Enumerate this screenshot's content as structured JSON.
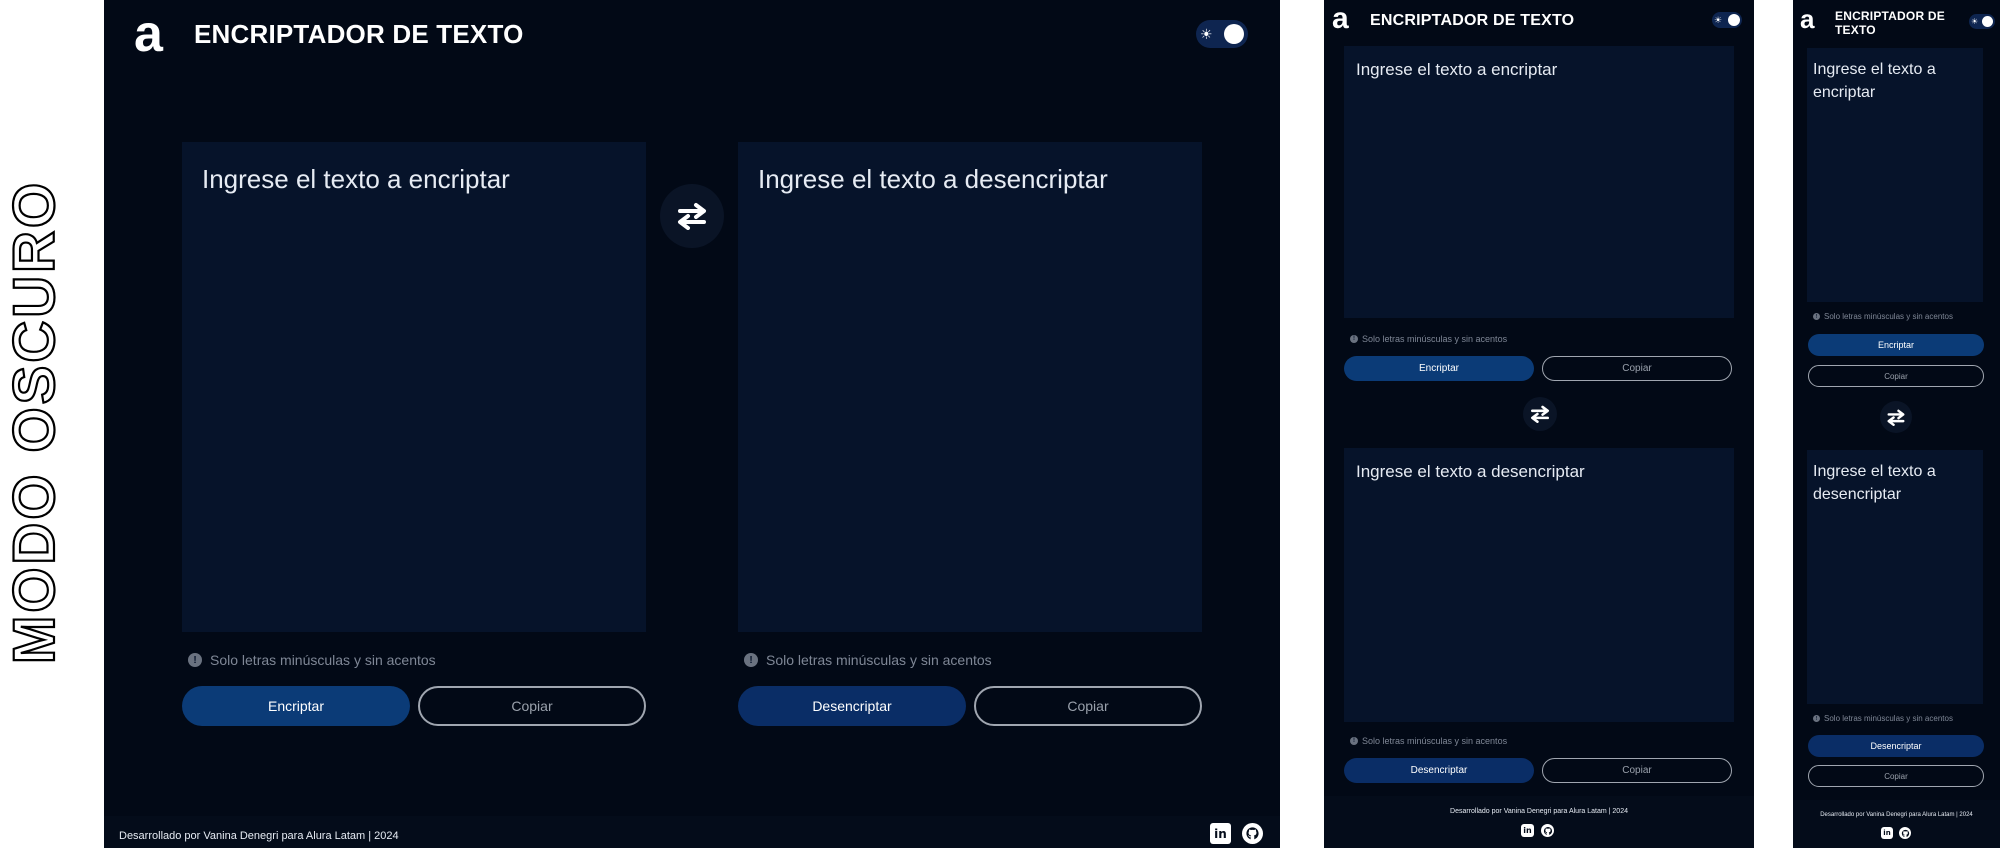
{
  "side_label": "MODO OSCURO",
  "app": {
    "logo": "a",
    "title": "ENCRIPTADOR DE TEXTO",
    "toggle_icon": "sun-icon"
  },
  "encrypt": {
    "placeholder": "Ingrese el texto a encriptar",
    "hint": "Solo letras minúsculas y sin acentos",
    "action_label": "Encriptar",
    "copy_label": "Copiar"
  },
  "decrypt": {
    "placeholder": "Ingrese el texto a desencriptar",
    "hint": "Solo letras minúsculas y sin acentos",
    "action_label": "Desencriptar",
    "copy_label": "Copiar"
  },
  "footer": {
    "credit": "Desarrollado por Vanina Denegri para Alura Latam | 2024",
    "linkedin_label": "in",
    "icons": [
      "linkedin-icon",
      "github-icon"
    ]
  },
  "colors": {
    "background": "#020916",
    "panel": "#06132a",
    "primary": "#0b3b77",
    "toggle": "#0e2550"
  }
}
